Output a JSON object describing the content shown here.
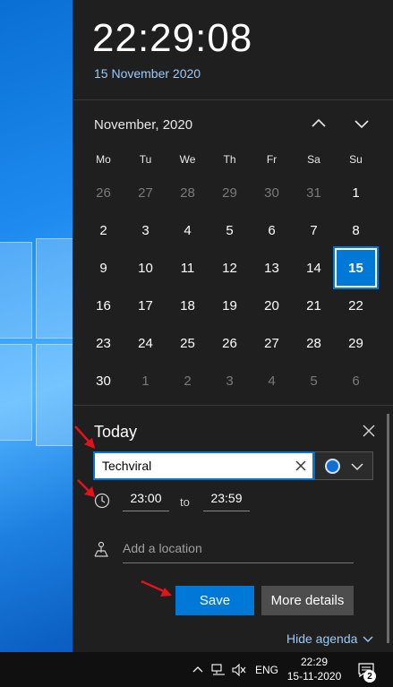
{
  "header": {
    "time": "22:29:08",
    "date": "15 November 2020"
  },
  "calendar": {
    "month_label": "November, 2020",
    "weekdays": [
      "Mo",
      "Tu",
      "We",
      "Th",
      "Fr",
      "Sa",
      "Su"
    ],
    "weeks": [
      [
        {
          "d": "26",
          "dim": true
        },
        {
          "d": "27",
          "dim": true
        },
        {
          "d": "28",
          "dim": true
        },
        {
          "d": "29",
          "dim": true
        },
        {
          "d": "30",
          "dim": true
        },
        {
          "d": "31",
          "dim": true
        },
        {
          "d": "1",
          "dim": false
        }
      ],
      [
        {
          "d": "2",
          "dim": false
        },
        {
          "d": "3",
          "dim": false
        },
        {
          "d": "4",
          "dim": false
        },
        {
          "d": "5",
          "dim": false
        },
        {
          "d": "6",
          "dim": false
        },
        {
          "d": "7",
          "dim": false
        },
        {
          "d": "8",
          "dim": false
        }
      ],
      [
        {
          "d": "9",
          "dim": false
        },
        {
          "d": "10",
          "dim": false
        },
        {
          "d": "11",
          "dim": false
        },
        {
          "d": "12",
          "dim": false
        },
        {
          "d": "13",
          "dim": false
        },
        {
          "d": "14",
          "dim": false
        },
        {
          "d": "15",
          "dim": false,
          "today": true
        }
      ],
      [
        {
          "d": "16",
          "dim": false
        },
        {
          "d": "17",
          "dim": false
        },
        {
          "d": "18",
          "dim": false
        },
        {
          "d": "19",
          "dim": false
        },
        {
          "d": "20",
          "dim": false
        },
        {
          "d": "21",
          "dim": false
        },
        {
          "d": "22",
          "dim": false
        }
      ],
      [
        {
          "d": "23",
          "dim": false
        },
        {
          "d": "24",
          "dim": false
        },
        {
          "d": "25",
          "dim": false
        },
        {
          "d": "26",
          "dim": false
        },
        {
          "d": "27",
          "dim": false
        },
        {
          "d": "28",
          "dim": false
        },
        {
          "d": "29",
          "dim": false
        }
      ],
      [
        {
          "d": "30",
          "dim": false
        },
        {
          "d": "1",
          "dim": true
        },
        {
          "d": "2",
          "dim": true
        },
        {
          "d": "3",
          "dim": true
        },
        {
          "d": "4",
          "dim": true
        },
        {
          "d": "5",
          "dim": true
        },
        {
          "d": "6",
          "dim": true
        }
      ]
    ],
    "prev_icon": "chevron-up-icon",
    "next_icon": "chevron-down-icon"
  },
  "agenda": {
    "title": "Today",
    "event_name": "Techviral",
    "event_color": "#0f6fd6",
    "start_time": "23:00",
    "to_label": "to",
    "end_time": "23:59",
    "location_placeholder": "Add a location",
    "save_label": "Save",
    "more_details_label": "More details",
    "hide_agenda_label": "Hide agenda"
  },
  "taskbar": {
    "language": "ENG",
    "time": "22:29",
    "date": "15-11-2020",
    "notification_count": "2"
  },
  "colors": {
    "accent": "#0078d7",
    "link": "#9ec9f5",
    "annotation_arrow": "#e3121b"
  }
}
